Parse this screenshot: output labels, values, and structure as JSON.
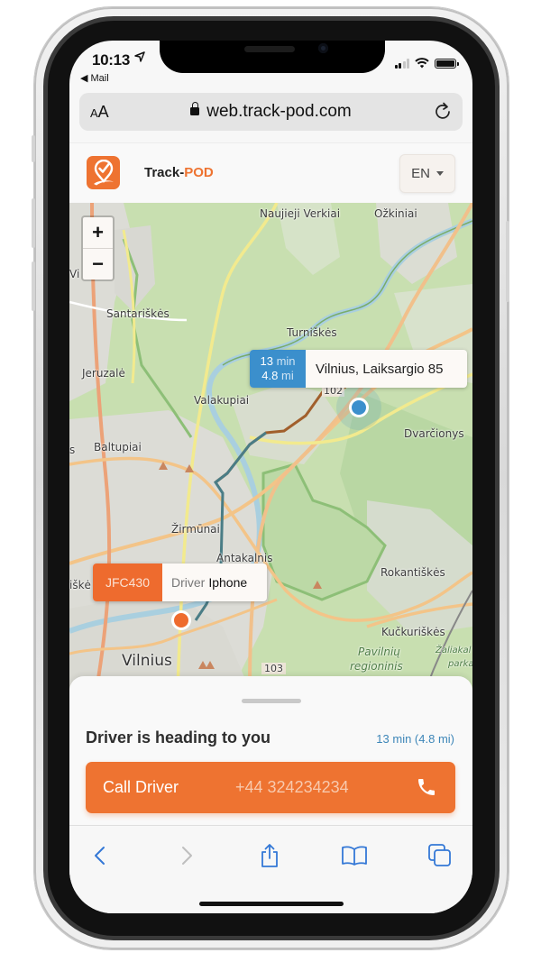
{
  "status_bar": {
    "time": "10:13",
    "back_app": "◀ Mail",
    "location_icon": "location-arrow-icon",
    "signal_bars_on": 2,
    "signal_bars_total": 4,
    "battery_level": 1.0
  },
  "browser": {
    "text_size_label": "AA",
    "url": "web.track-pod.com",
    "icons": {
      "secure": "lock-icon",
      "reload": "reload-icon"
    }
  },
  "header": {
    "brand_prefix": "Track-",
    "brand_suffix": "POD",
    "language": "EN",
    "logo_icon": "track-pod-logo-icon",
    "brand_color": "#ee7331"
  },
  "map": {
    "zoom_in_label": "+",
    "zoom_out_label": "−",
    "labels": {
      "naujieji_verkiai": "Naujieji Verkiai",
      "ozkiniai": "Ožkiniai",
      "santariskes": "Santariškės",
      "turniskes": "Turniškės",
      "jeruzale": "Jeruzalė",
      "valakupiai": "Valakupiai",
      "dvarcionys": "Dvarčionys",
      "baltupiai": "Baltupiai",
      "zirmunai": "Žirmūnai",
      "antakalnis": "Antakalnis",
      "rokantiskes": "Rokantiškės",
      "kuckuriskes": "Kučkuriškės",
      "vilnius": "Vilnius",
      "pavilniu": "Pavilnių",
      "regioninis": "regioninis",
      "zaliakalnio": "Žaliakal",
      "parkas": "parka",
      "road_102": "102",
      "road_103": "103",
      "partial_vi": "Vi",
      "partial_s": "s",
      "partial_iske": "iškė"
    },
    "destination": {
      "eta_value": "13",
      "eta_unit": "min",
      "distance_value": "4.8",
      "distance_unit": "mi",
      "address": "Vilnius, Laiksargio 85",
      "color": "#3b8fcc"
    },
    "driver": {
      "vehicle_id": "JFC430",
      "label": "Driver",
      "name": "Iphone",
      "color": "#ee6b2e"
    }
  },
  "sheet": {
    "title": "Driver is heading to you",
    "eta_summary": "13 min (4.8 mi)",
    "call_label": "Call Driver",
    "phone": "+44 324234234",
    "call_icon": "phone-icon"
  },
  "toolbar": {
    "back": "chevron-left-icon",
    "forward": "chevron-right-icon",
    "share": "share-icon",
    "bookmarks": "book-icon",
    "tabs": "tabs-icon",
    "accent": "#3478d6"
  }
}
